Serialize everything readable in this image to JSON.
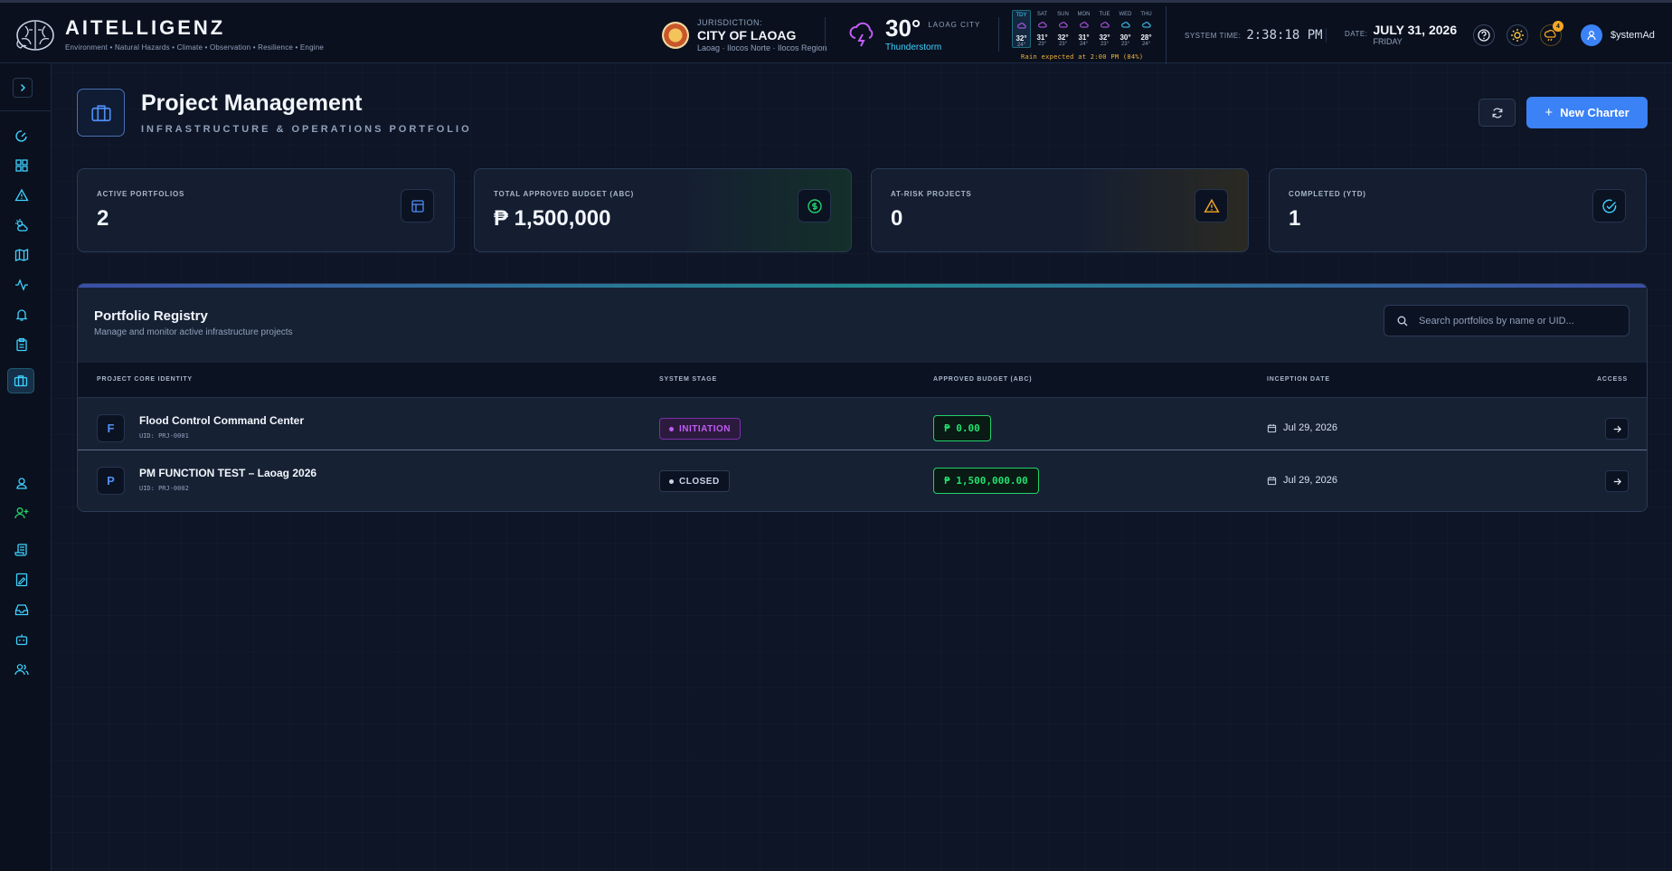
{
  "header": {
    "brand": "AITELLIGENZ",
    "tagline": "Environment • Natural Hazards • Climate • Observation • Resilience • Engine",
    "jurisdiction_label": "JURISDICTION:",
    "jurisdiction_name": "CITY OF LAOAG",
    "jurisdiction_sub": "Laoag · Ilocos Norte · Ilocos Region",
    "weather_temp": "30°",
    "weather_city": "LAOAG CITY",
    "weather_condition": "Thunderstorm",
    "forecast": [
      {
        "day": "TDY",
        "hi": "32°",
        "lo": "24°",
        "today": true
      },
      {
        "day": "SAT",
        "hi": "31°",
        "lo": "23°"
      },
      {
        "day": "SUN",
        "hi": "32°",
        "lo": "23°"
      },
      {
        "day": "MON",
        "hi": "31°",
        "lo": "24°"
      },
      {
        "day": "TUE",
        "hi": "32°",
        "lo": "23°"
      },
      {
        "day": "WED",
        "hi": "30°",
        "lo": "23°"
      },
      {
        "day": "THU",
        "hi": "28°",
        "lo": "24°"
      }
    ],
    "rain_note": "Rain expected at 2:00 PM (84%)",
    "system_time_label": "SYSTEM TIME:",
    "system_time": "2:38:18 PM",
    "date_label": "DATE:",
    "date": "JULY 31, 2026",
    "weekday": "FRIDAY",
    "notification_count": "4",
    "username": "$ystemAd"
  },
  "page": {
    "title": "Project Management",
    "subtitle": "INFRASTRUCTURE & OPERATIONS PORTFOLIO",
    "new_button": "New Charter",
    "new_button_plus": "+"
  },
  "stats": [
    {
      "label": "ACTIVE PORTFOLIOS",
      "value": "2",
      "icon": "layout-icon",
      "color": "#4f8ef7"
    },
    {
      "label": "TOTAL APPROVED BUDGET (ABC)",
      "value": "₱ 1,500,000",
      "icon": "dollar-circle-icon",
      "color": "#22d16a"
    },
    {
      "label": "AT-RISK PROJECTS",
      "value": "0",
      "icon": "warning-icon",
      "color": "#f5a623"
    },
    {
      "label": "COMPLETED (YTD)",
      "value": "1",
      "icon": "check-circle-icon",
      "color": "#3fd2ff"
    }
  ],
  "registry": {
    "title": "Portfolio Registry",
    "subtitle": "Manage and monitor active infrastructure projects",
    "search_placeholder": "Search portfolios by name or UID...",
    "columns": [
      "PROJECT CORE IDENTITY",
      "SYSTEM STAGE",
      "APPROVED BUDGET (ABC)",
      "INCEPTION DATE",
      "ACCESS"
    ],
    "rows": [
      {
        "initial": "F",
        "name": "Flood Control Command Center",
        "uid": "UID: PRJ-0001",
        "stage": "INITIATION",
        "budget": "₱ 0.00",
        "date": "Jul 29, 2026"
      },
      {
        "initial": "P",
        "name": "PM FUNCTION TEST – Laoag 2026",
        "uid": "UID: PRJ-0002",
        "stage": "CLOSED",
        "budget": "₱ 1,500,000.00",
        "date": "Jul 29, 2026"
      }
    ]
  },
  "colors": {
    "accent": "#3b82f6",
    "success": "#22d16a",
    "warning": "#f5a623",
    "info": "#3fd2ff",
    "stage_initiation": "#c05cf5"
  }
}
